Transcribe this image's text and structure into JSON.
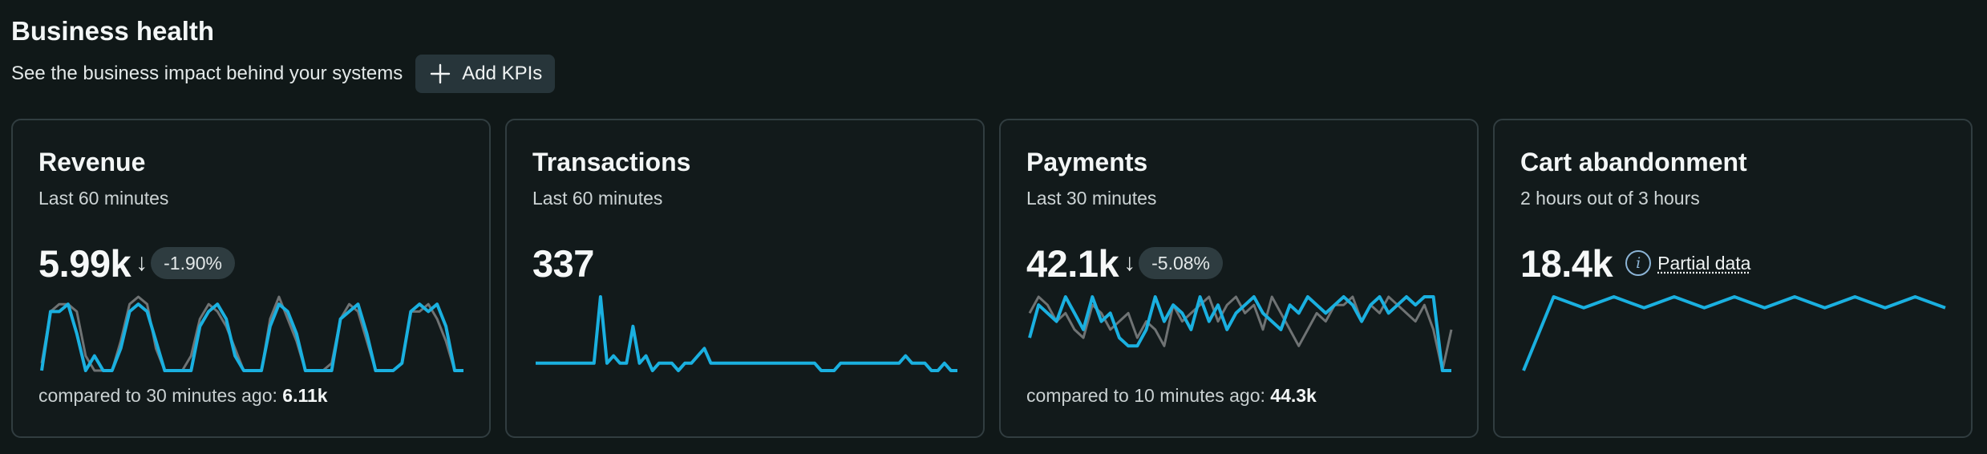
{
  "header": {
    "title": "Business health",
    "subtitle": "See the business impact behind your systems",
    "add_button_label": "Add KPIs",
    "add_button_icon": "plus-icon"
  },
  "colors": {
    "current_series": "#1ab0e0",
    "previous_series": "#6f7374"
  },
  "cards": [
    {
      "title": "Revenue",
      "period": "Last 60 minutes",
      "value": "5.99k",
      "delta_arrow": "↓",
      "delta": "-1.90%",
      "compare_label": "compared to 30 minutes ago:",
      "compare_value": "6.11k",
      "current": [
        0,
        8,
        8,
        9,
        5,
        0,
        2,
        0,
        0,
        3,
        8,
        9,
        8,
        4,
        0,
        0,
        0,
        0,
        6,
        8,
        9,
        7,
        2,
        0,
        0,
        0,
        6,
        9,
        8,
        5,
        0,
        0,
        0,
        0,
        7,
        8,
        9,
        5,
        0,
        0,
        0,
        1,
        8,
        9,
        8,
        9,
        6,
        0,
        0
      ],
      "previous": [
        1,
        8,
        9,
        9,
        8,
        2,
        0,
        0,
        0,
        4,
        9,
        10,
        9,
        3,
        0,
        0,
        0,
        2,
        7,
        9,
        8,
        6,
        3,
        0,
        0,
        0,
        7,
        10,
        7,
        4,
        0,
        0,
        0,
        1,
        7,
        9,
        8,
        4,
        0,
        0,
        0,
        1,
        8,
        8,
        9,
        7,
        4,
        0,
        0
      ]
    },
    {
      "title": "Transactions",
      "period": "Last 60 minutes",
      "value": "337",
      "current": [
        1,
        1,
        1,
        1,
        1,
        1,
        1,
        1,
        1,
        1,
        10,
        1,
        2,
        1,
        1,
        6,
        1,
        2,
        0,
        1,
        1,
        1,
        0,
        1,
        1,
        2,
        3,
        1,
        1,
        1,
        1,
        1,
        1,
        1,
        1,
        1,
        1,
        1,
        1,
        1,
        1,
        1,
        1,
        1,
        0,
        0,
        0,
        1,
        1,
        1,
        1,
        1,
        1,
        1,
        1,
        1,
        1,
        2,
        1,
        1,
        1,
        0,
        0,
        1,
        0,
        0
      ],
      "previous": []
    },
    {
      "title": "Payments",
      "period": "Last 30 minutes",
      "value": "42.1k",
      "delta_arrow": "↓",
      "delta": "-5.08%",
      "compare_label": "compared to 10 minutes ago:",
      "compare_value": "44.3k",
      "current": [
        4,
        8,
        7,
        6,
        9,
        7,
        5,
        9,
        6,
        7,
        4,
        3,
        3,
        5,
        9,
        6,
        8,
        7,
        5,
        9,
        6,
        8,
        5,
        7,
        8,
        9,
        7,
        6,
        5,
        8,
        7,
        9,
        8,
        7,
        8,
        9,
        8,
        6,
        8,
        9,
        7,
        8,
        9,
        8,
        9,
        9,
        0,
        0
      ],
      "previous": [
        7,
        9,
        8,
        6,
        7,
        5,
        4,
        8,
        7,
        5,
        6,
        7,
        4,
        6,
        5,
        3,
        8,
        6,
        7,
        8,
        9,
        6,
        8,
        9,
        7,
        8,
        5,
        9,
        7,
        5,
        3,
        5,
        7,
        6,
        8,
        8,
        9,
        6,
        8,
        7,
        9,
        8,
        7,
        6,
        8,
        5,
        0,
        5
      ]
    },
    {
      "title": "Cart abandonment",
      "period": "2 hours out of 3 hours",
      "value": "18.4k",
      "info_icon": "info-icon",
      "info_label": "Partial data",
      "current": [
        0,
        10,
        8.5,
        10,
        8.5,
        10,
        8.5,
        10,
        8.5,
        10,
        8.5,
        10,
        8.5,
        10,
        8.5
      ],
      "previous": []
    }
  ]
}
